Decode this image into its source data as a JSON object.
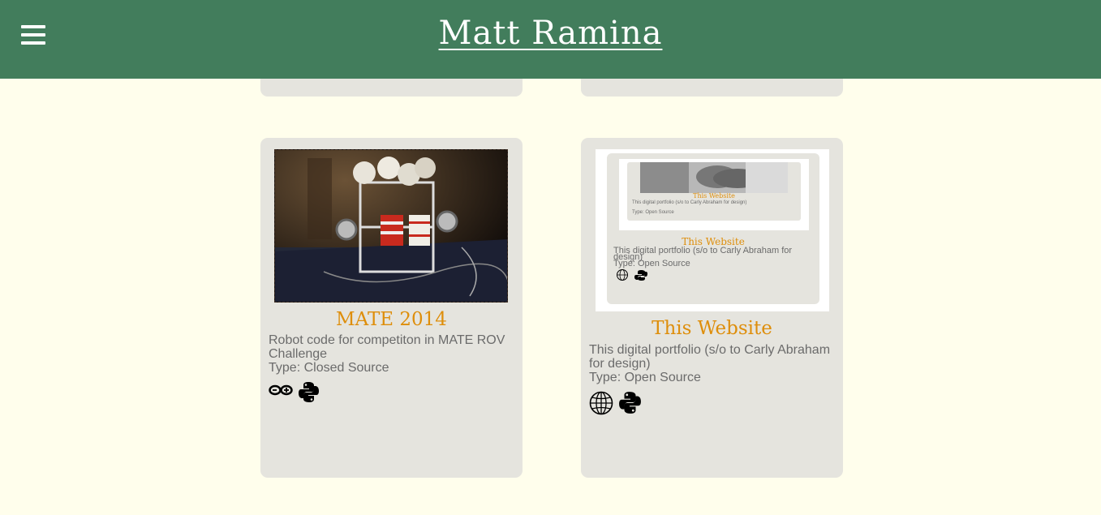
{
  "header": {
    "title": "Matt Ramina",
    "bg_color": "#427d5c"
  },
  "projects": [
    {
      "title": "MATE 2014",
      "description": "Robot code for competiton in MATE ROV Challenge",
      "type": "Type: Closed Source",
      "icons": [
        "arduino-icon",
        "python-icon"
      ]
    },
    {
      "title": "This Website",
      "description": "This digital portfolio (s/o to Carly Abraham for design)",
      "type": "Type: Open Source",
      "icons": [
        "globe-icon",
        "python-icon"
      ]
    }
  ],
  "thumbnail": {
    "title": "This Website",
    "description": "This digital portfolio (s/o to Carly Abraham for design)",
    "type": "Type: Open Source",
    "inner_title": "This Website",
    "inner_description": "This digital portfolio (s/o to Carly Abraham for design)",
    "inner_type": "Type: Open Source"
  },
  "colors": {
    "accent": "#de8e0b",
    "card_bg": "#e5e4de",
    "page_bg": "#fffeec"
  }
}
